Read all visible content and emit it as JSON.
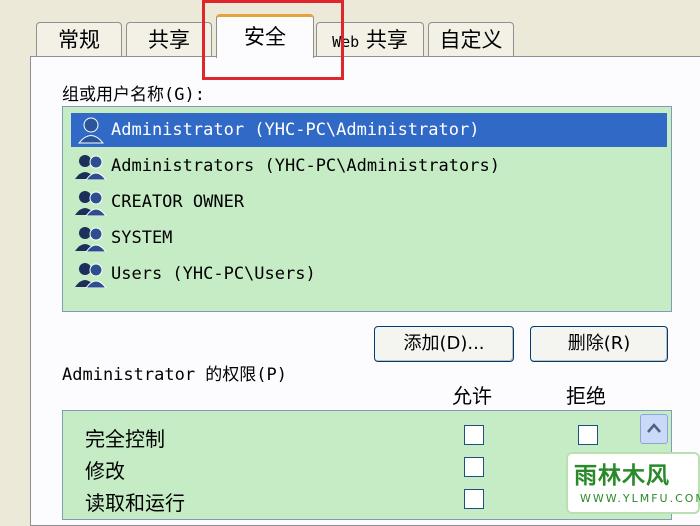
{
  "tabs": [
    {
      "label": "常规"
    },
    {
      "label": "共享"
    },
    {
      "label": "安全"
    },
    {
      "label_prefix": "Web",
      "label_suffix": " 共享"
    },
    {
      "label": "自定义"
    }
  ],
  "groups": {
    "label": "组或用户名称(G):",
    "items": [
      {
        "label": "Administrator (YHC-PC\\Administrator)",
        "selected": true
      },
      {
        "label": "Administrators (YHC-PC\\Administrators)"
      },
      {
        "label": "CREATOR OWNER"
      },
      {
        "label": "SYSTEM"
      },
      {
        "label": "Users (YHC-PC\\Users)"
      }
    ],
    "add_button": "添加(D)...",
    "remove_button": "删除(R)"
  },
  "permissions": {
    "label": "Administrator 的权限(P)",
    "allow_header": "允许",
    "deny_header": "拒绝",
    "items": [
      {
        "label": "完全控制"
      },
      {
        "label": "修改"
      },
      {
        "label": "读取和运行"
      }
    ]
  },
  "watermark": {
    "title": "雨林木风",
    "url": "WWW.YLMFU.COM"
  },
  "colors": {
    "highlight": "#e0262d",
    "list_background": "#c6ecc6",
    "selection": "#3169c6"
  }
}
